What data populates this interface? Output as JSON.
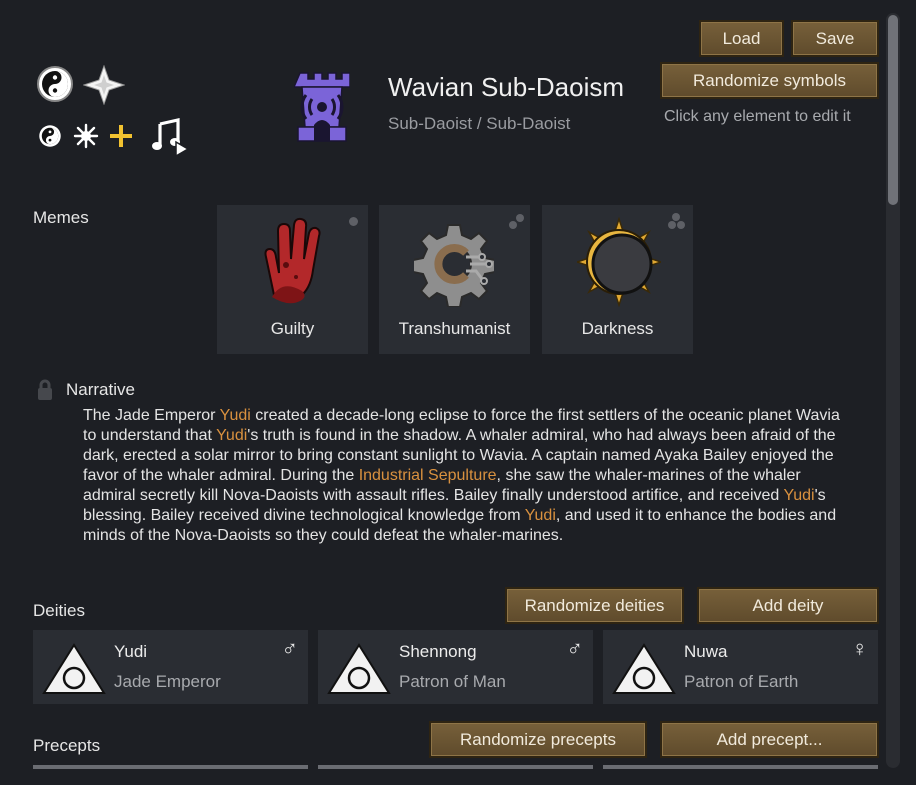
{
  "header": {
    "title": "Wavian Sub-Daoism",
    "subtitle": "Sub-Daoist / Sub-Daoist",
    "hint": "Click any element to edit it",
    "load_label": "Load",
    "save_label": "Save",
    "randomize_symbols_label": "Randomize symbols"
  },
  "symbols": {
    "icons": [
      "yin-yang",
      "four-point-star",
      "small-yin-yang",
      "sun-burst",
      "gold-cross",
      "music-note"
    ],
    "main_icon": "tower-signal",
    "main_icon_color": "#7b64d8"
  },
  "memes": {
    "label": "Memes",
    "items": [
      {
        "name": "Guilty",
        "icon": "bloody-hand",
        "color": "#b3282a"
      },
      {
        "name": "Transhumanist",
        "icon": "gear-circuit",
        "color": "#9a9a9a"
      },
      {
        "name": "Darkness",
        "icon": "eclipse",
        "color": "#e0a832"
      }
    ]
  },
  "narrative": {
    "label": "Narrative",
    "segments": [
      {
        "t": "The Jade Emperor ",
        "hl": false
      },
      {
        "t": "Yudi",
        "hl": true
      },
      {
        "t": " created a decade-long eclipse to force the first settlers of the oceanic planet Wavia to understand that ",
        "hl": false
      },
      {
        "t": "Yudi",
        "hl": true
      },
      {
        "t": "'s truth is found in the shadow. A whaler admiral, who had always been afraid of the dark, erected a solar mirror to bring constant sunlight to Wavia. A captain named Ayaka Bailey enjoyed the favor of the whaler admiral. During the ",
        "hl": false
      },
      {
        "t": "Industrial Sepulture",
        "hl": true
      },
      {
        "t": ", she saw the whaler-marines of the whaler admiral secretly kill Nova-Daoists with assault rifles. Bailey finally understood artifice, and received ",
        "hl": false
      },
      {
        "t": "Yudi",
        "hl": true
      },
      {
        "t": "'s blessing. Bailey received divine technological knowledge from ",
        "hl": false
      },
      {
        "t": "Yudi",
        "hl": true
      },
      {
        "t": ", and used it to enhance the bodies and minds of the Nova-Daoists so they could defeat the whaler-marines.",
        "hl": false
      }
    ],
    "highlight_color": "#d9913f"
  },
  "deities": {
    "label": "Deities",
    "randomize_label": "Randomize deities",
    "add_label": "Add deity",
    "items": [
      {
        "name": "Yudi",
        "title": "Jade Emperor",
        "gender": "♂"
      },
      {
        "name": "Shennong",
        "title": "Patron of Man",
        "gender": "♂"
      },
      {
        "name": "Nuwa",
        "title": "Patron of Earth",
        "gender": "♀"
      }
    ]
  },
  "precepts": {
    "label": "Precepts",
    "randomize_label": "Randomize precepts",
    "add_label": "Add precept..."
  }
}
